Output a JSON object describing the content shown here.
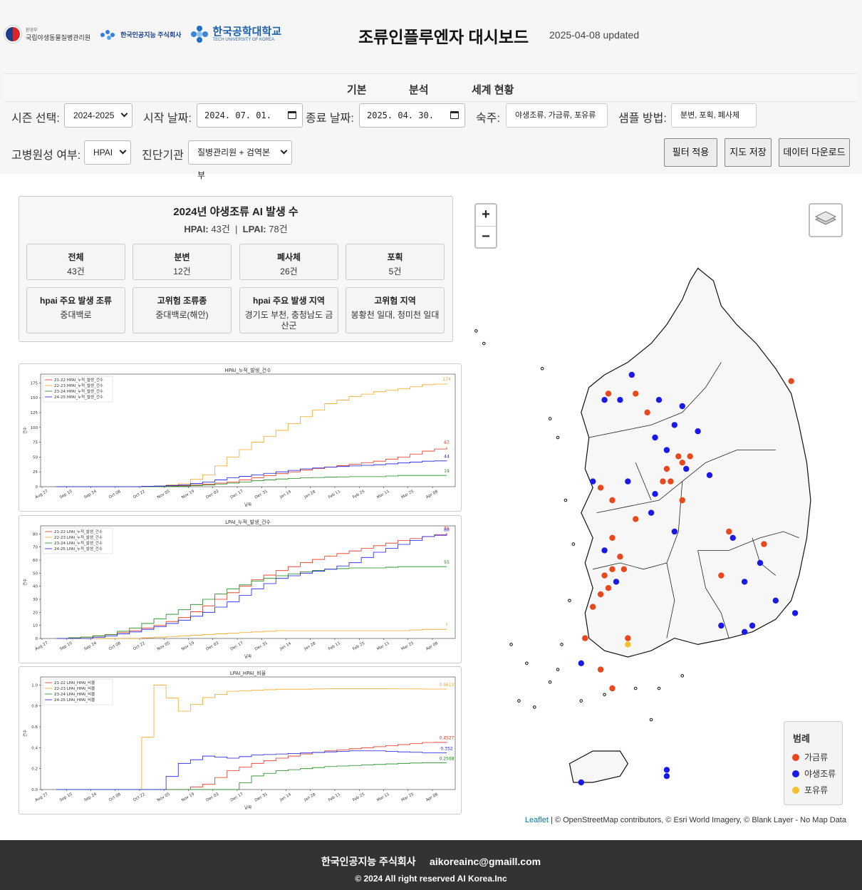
{
  "header": {
    "logos": {
      "a_small": "환경부",
      "a_name": "국립야생동물질병관리원",
      "b_name": "한국인공지능 주식회사",
      "c_name": "한국공학대학교",
      "c_sub": "TECH UNIVERSITY OF KOREA"
    },
    "title": "조류인플루엔자 대시보드",
    "updated": "2025-04-08 updated"
  },
  "nav": {
    "tabs": [
      "기본",
      "분석",
      "세계 현황"
    ]
  },
  "filters": {
    "season_label": "시즌 선택:",
    "season_value": "2024-2025",
    "start_label": "시작 날짜:",
    "start_value": "2024. 07. 01.",
    "end_label": "종료 날짜:",
    "end_value": "2025. 04. 30.",
    "host_label": "숙주:",
    "host_value": "야생조류, 가금류, 포유류",
    "sample_label": "샘플 방법:",
    "sample_value": "분변, 포획, 폐사체",
    "path_label": "고병원성 여부:",
    "path_value": "HPAI",
    "agency_label": "진단기관",
    "agency_value": "질병관리원 + 검역본부",
    "apply_button": "필터 적용",
    "save_map_button": "지도 저장",
    "download_button": "데이터 다운로드"
  },
  "stats": {
    "title": "2024년 야생조류 AI 발생 수",
    "hpai_label": "HPAI:",
    "hpai_value": "43건",
    "lpai_label": "LPAI:",
    "lpai_value": "78건",
    "sep": "|",
    "cards": [
      {
        "h": "전체",
        "v": "43건"
      },
      {
        "h": "분변",
        "v": "12건"
      },
      {
        "h": "폐사체",
        "v": "26건"
      },
      {
        "h": "포획",
        "v": "5건"
      },
      {
        "h": "hpai 주요 발생 조류",
        "v": "중대백로"
      },
      {
        "h": "고위험 조류종",
        "v": "중대백로(해안)"
      },
      {
        "h": "hpai 주요 발생 지역",
        "v": "경기도 부천, 충청남도 금산군"
      },
      {
        "h": "고위험 지역",
        "v": "봉황천 일대, 청미천 일대"
      }
    ]
  },
  "chart_data": [
    {
      "type": "line",
      "title": "HPAI_누적_발생_건수",
      "xlabel": "날짜",
      "ylabel": "건수",
      "x": [
        "Aug 27",
        "Sep 10",
        "Sep 24",
        "Oct 08",
        "Oct 22",
        "Nov 05",
        "Nov 19",
        "Dec 03",
        "Dec 17",
        "Dec 31",
        "Jan 14",
        "Jan 28",
        "Feb 11",
        "Feb 25",
        "Mar 11",
        "Mar 25",
        "Apr 08"
      ],
      "ylim": [
        0,
        185
      ],
      "yticks": [
        0,
        25,
        50,
        75,
        100,
        125,
        150,
        175
      ],
      "legend": "top-left",
      "grid": false,
      "series": [
        {
          "name": "21-22 HPAI_누적_발생_건수",
          "color": "#e8311a",
          "values": [
            0,
            0,
            0,
            0,
            1,
            2,
            4,
            8,
            15,
            22,
            28,
            33,
            38,
            43,
            50,
            60,
            67
          ],
          "end_label": "67"
        },
        {
          "name": "22-23 HPAI_누적_발생_건수",
          "color": "#f5a623",
          "values": [
            0,
            0,
            0,
            0,
            1,
            5,
            20,
            50,
            75,
            95,
            118,
            140,
            152,
            160,
            165,
            172,
            174
          ],
          "end_label": "174"
        },
        {
          "name": "23-24 HPAI_누적_발생_건수",
          "color": "#1a8a1a",
          "values": [
            0,
            0,
            0,
            0,
            0,
            1,
            3,
            6,
            10,
            13,
            15,
            16,
            17,
            17,
            19,
            19,
            19
          ],
          "end_label": "19"
        },
        {
          "name": "24-25 HPAI_누적_발생_건수",
          "color": "#1a1ae8",
          "values": [
            0,
            0,
            0,
            0,
            1,
            3,
            8,
            15,
            20,
            25,
            30,
            33,
            35,
            37,
            40,
            43,
            44
          ],
          "end_label": "44"
        }
      ]
    },
    {
      "type": "line",
      "title": "LPAI_누적_발생_건수",
      "xlabel": "날짜",
      "ylabel": "건수",
      "x": [
        "Aug 27",
        "Sep 10",
        "Sep 24",
        "Oct 08",
        "Oct 22",
        "Nov 05",
        "Nov 19",
        "Dec 03",
        "Dec 17",
        "Dec 31",
        "Jan 14",
        "Jan 28",
        "Feb 11",
        "Feb 25",
        "Mar 11",
        "Mar 25",
        "Apr 08"
      ],
      "ylim": [
        0,
        84
      ],
      "yticks": [
        0,
        10,
        20,
        30,
        40,
        50,
        60,
        70,
        80
      ],
      "legend": "top-left",
      "grid": false,
      "series": [
        {
          "name": "21-22 LPAI_누적_발생_건수",
          "color": "#e8311a",
          "values": [
            0,
            1,
            3,
            6,
            10,
            16,
            25,
            35,
            45,
            52,
            58,
            63,
            67,
            71,
            75,
            78,
            81
          ],
          "end_label": "81"
        },
        {
          "name": "22-23 LPAI_누적_발생_건수",
          "color": "#f5a623",
          "values": [
            0,
            0,
            0,
            0,
            1,
            2,
            3,
            4,
            5,
            6,
            6,
            6,
            6,
            6,
            6,
            7,
            7
          ],
          "end_label": "7"
        },
        {
          "name": "23-24 LPAI_누적_발생_건수",
          "color": "#1a8a1a",
          "values": [
            0,
            1,
            3,
            8,
            15,
            22,
            30,
            38,
            44,
            48,
            51,
            53,
            54,
            54,
            55,
            55,
            55
          ],
          "end_label": "55"
        },
        {
          "name": "24-25 LPAI_누적_발생_건수",
          "color": "#1a1ae8",
          "values": [
            0,
            0,
            2,
            5,
            9,
            14,
            20,
            28,
            38,
            46,
            50,
            53,
            58,
            66,
            72,
            78,
            80
          ],
          "end_label": "80"
        }
      ]
    },
    {
      "type": "line",
      "title": "LPAI_HPAI_비율",
      "xlabel": "날짜",
      "ylabel": "건수",
      "x": [
        "Aug 27",
        "Sep 10",
        "Sep 24",
        "Oct 08",
        "Oct 22",
        "Nov 05",
        "Nov 19",
        "Dec 03",
        "Dec 17",
        "Dec 31",
        "Jan 14",
        "Jan 28",
        "Feb 11",
        "Feb 25",
        "Mar 11",
        "Mar 25",
        "Apr 08"
      ],
      "ylim": [
        0,
        1.05
      ],
      "yticks": [
        0.0,
        0.2,
        0.4,
        0.6,
        0.8,
        1.0
      ],
      "legend": "top-left",
      "grid": false,
      "series": [
        {
          "name": "21-22 LPAI_HPAI_비율",
          "color": "#e8311a",
          "values": [
            0,
            0,
            0,
            0,
            0,
            0,
            0.05,
            0.18,
            0.25,
            0.3,
            0.34,
            0.37,
            0.39,
            0.41,
            0.43,
            0.45,
            0.4527
          ],
          "end_label": "0.4527"
        },
        {
          "name": "22-23 LPAI_HPAI_비율",
          "color": "#f5a623",
          "values": [
            0,
            0,
            0,
            0,
            1.0,
            0.75,
            0.88,
            0.94,
            0.95,
            0.96,
            0.96,
            0.965,
            0.965,
            0.965,
            0.963,
            0.9613,
            0.9613
          ],
          "end_label": "0.9613"
        },
        {
          "name": "23-24 LPAI_HPAI_비율",
          "color": "#1a8a1a",
          "values": [
            0,
            0,
            0,
            0,
            0,
            0,
            0,
            0,
            0.13,
            0.18,
            0.2,
            0.22,
            0.23,
            0.24,
            0.25,
            0.2568,
            0.2568
          ],
          "end_label": "0.2568"
        },
        {
          "name": "24-25 LPAI_HPAI_비율",
          "color": "#1a1ae8",
          "values": [
            0,
            0,
            0,
            0,
            0,
            0.25,
            0.32,
            0.3,
            0.33,
            0.34,
            0.35,
            0.36,
            0.37,
            0.37,
            0.36,
            0.352,
            0.352
          ],
          "end_label": "0.352"
        }
      ]
    }
  ],
  "map": {
    "zoom_in": "+",
    "zoom_out": "−",
    "layers_icon": "layers-icon",
    "legend_title": "범례",
    "legend_items": [
      {
        "label": "가금류",
        "color": "#e8481c"
      },
      {
        "label": "야생조류",
        "color": "#1a1ae8"
      },
      {
        "label": "포유류",
        "color": "#f2c12e"
      }
    ],
    "attribution_link": "Leaflet",
    "attribution_rest": " | © OpenStreetMap contributors, © Esri World Imagery, © Blank Layer - No Map Data",
    "points": [
      {
        "x": 0.43,
        "y": 0.3,
        "t": "w"
      },
      {
        "x": 0.37,
        "y": 0.33,
        "t": "p"
      },
      {
        "x": 0.36,
        "y": 0.34,
        "t": "w"
      },
      {
        "x": 0.4,
        "y": 0.34,
        "t": "w"
      },
      {
        "x": 0.44,
        "y": 0.33,
        "t": "p"
      },
      {
        "x": 0.47,
        "y": 0.36,
        "t": "p"
      },
      {
        "x": 0.5,
        "y": 0.34,
        "t": "w"
      },
      {
        "x": 0.56,
        "y": 0.35,
        "t": "w"
      },
      {
        "x": 0.49,
        "y": 0.4,
        "t": "w"
      },
      {
        "x": 0.52,
        "y": 0.42,
        "t": "w"
      },
      {
        "x": 0.54,
        "y": 0.38,
        "t": "w"
      },
      {
        "x": 0.6,
        "y": 0.39,
        "t": "w"
      },
      {
        "x": 0.55,
        "y": 0.43,
        "t": "p"
      },
      {
        "x": 0.56,
        "y": 0.44,
        "t": "p"
      },
      {
        "x": 0.58,
        "y": 0.43,
        "t": "p"
      },
      {
        "x": 0.52,
        "y": 0.45,
        "t": "p"
      },
      {
        "x": 0.51,
        "y": 0.47,
        "t": "p"
      },
      {
        "x": 0.53,
        "y": 0.47,
        "t": "p"
      },
      {
        "x": 0.49,
        "y": 0.49,
        "t": "w"
      },
      {
        "x": 0.56,
        "y": 0.5,
        "t": "p"
      },
      {
        "x": 0.48,
        "y": 0.52,
        "t": "w"
      },
      {
        "x": 0.44,
        "y": 0.53,
        "t": "p"
      },
      {
        "x": 0.38,
        "y": 0.5,
        "t": "p"
      },
      {
        "x": 0.42,
        "y": 0.47,
        "t": "w"
      },
      {
        "x": 0.33,
        "y": 0.47,
        "t": "w"
      },
      {
        "x": 0.35,
        "y": 0.48,
        "t": "p"
      },
      {
        "x": 0.63,
        "y": 0.46,
        "t": "w"
      },
      {
        "x": 0.57,
        "y": 0.45,
        "t": "w"
      },
      {
        "x": 0.54,
        "y": 0.55,
        "t": "w"
      },
      {
        "x": 0.38,
        "y": 0.56,
        "t": "p"
      },
      {
        "x": 0.36,
        "y": 0.58,
        "t": "w"
      },
      {
        "x": 0.4,
        "y": 0.59,
        "t": "p"
      },
      {
        "x": 0.41,
        "y": 0.61,
        "t": "p"
      },
      {
        "x": 0.38,
        "y": 0.61,
        "t": "p"
      },
      {
        "x": 0.36,
        "y": 0.62,
        "t": "p"
      },
      {
        "x": 0.39,
        "y": 0.63,
        "t": "w"
      },
      {
        "x": 0.37,
        "y": 0.64,
        "t": "p"
      },
      {
        "x": 0.35,
        "y": 0.65,
        "t": "p"
      },
      {
        "x": 0.68,
        "y": 0.55,
        "t": "p"
      },
      {
        "x": 0.69,
        "y": 0.56,
        "t": "w"
      },
      {
        "x": 0.66,
        "y": 0.62,
        "t": "p"
      },
      {
        "x": 0.72,
        "y": 0.63,
        "t": "w"
      },
      {
        "x": 0.77,
        "y": 0.57,
        "t": "p"
      },
      {
        "x": 0.76,
        "y": 0.6,
        "t": "w"
      },
      {
        "x": 0.84,
        "y": 0.31,
        "t": "p"
      },
      {
        "x": 0.8,
        "y": 0.66,
        "t": "w"
      },
      {
        "x": 0.74,
        "y": 0.7,
        "t": "w"
      },
      {
        "x": 0.72,
        "y": 0.71,
        "t": "w"
      },
      {
        "x": 0.66,
        "y": 0.7,
        "t": "w"
      },
      {
        "x": 0.85,
        "y": 0.68,
        "t": "w"
      },
      {
        "x": 0.33,
        "y": 0.67,
        "t": "p"
      },
      {
        "x": 0.31,
        "y": 0.72,
        "t": "p"
      },
      {
        "x": 0.3,
        "y": 0.76,
        "t": "w"
      },
      {
        "x": 0.35,
        "y": 0.77,
        "t": "p"
      },
      {
        "x": 0.38,
        "y": 0.8,
        "t": "p"
      },
      {
        "x": 0.42,
        "y": 0.72,
        "t": "p"
      },
      {
        "x": 0.42,
        "y": 0.73,
        "t": "m"
      },
      {
        "x": 0.52,
        "y": 0.93,
        "t": "w"
      },
      {
        "x": 0.52,
        "y": 0.94,
        "t": "w"
      },
      {
        "x": 0.3,
        "y": 0.95,
        "t": "w"
      }
    ]
  },
  "footer": {
    "company": "한국인공지능 주식회사",
    "email": "aikoreainc@gmaill.com",
    "copyright": "© 2024 All right reserved AI Korea.Inc"
  }
}
